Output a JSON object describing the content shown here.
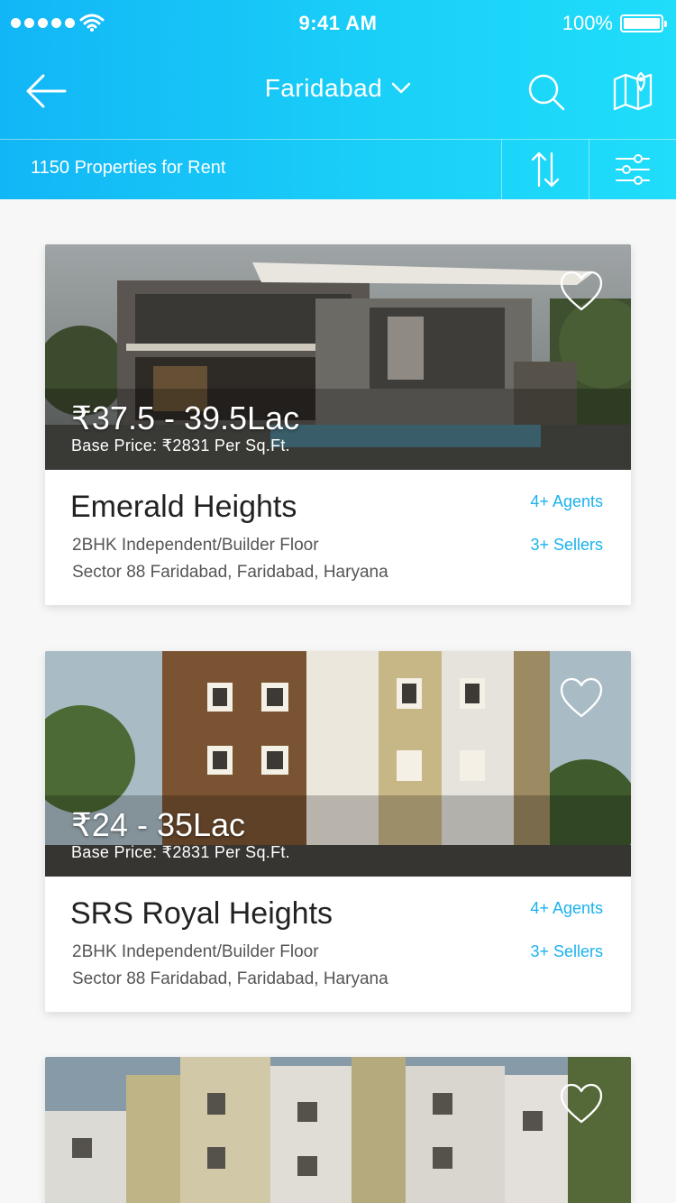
{
  "status": {
    "time": "9:41 AM",
    "battery": "100%"
  },
  "nav": {
    "city": "Faridabad",
    "back_icon": "arrow-left-icon",
    "search_icon": "search-icon",
    "map_icon": "map-pin-icon"
  },
  "subbar": {
    "count_text": "1150 Properties for Rent",
    "sort_icon": "sort-icon",
    "filter_icon": "filter-icon"
  },
  "colors": {
    "header_start": "#12b6f6",
    "header_end": "#20ddfa",
    "accent": "#1ab2ee"
  },
  "listings": [
    {
      "price": "₹37.5 - 39.5Lac",
      "base_price": "Base Price:  ₹2831 Per Sq.Ft.",
      "name": "Emerald Heights",
      "type": "2BHK Independent/Builder Floor",
      "address": "Sector 88 Faridabad, Faridabad, Haryana",
      "agents": "4+ Agents",
      "sellers": "3+ Sellers"
    },
    {
      "price": "₹24 - 35Lac",
      "base_price": "Base Price:  ₹2831 Per Sq.Ft.",
      "name": "SRS Royal Heights",
      "type": "2BHK Independent/Builder Floor",
      "address": "Sector 88 Faridabad, Faridabad, Haryana",
      "agents": "4+ Agents",
      "sellers": "3+ Sellers"
    }
  ]
}
